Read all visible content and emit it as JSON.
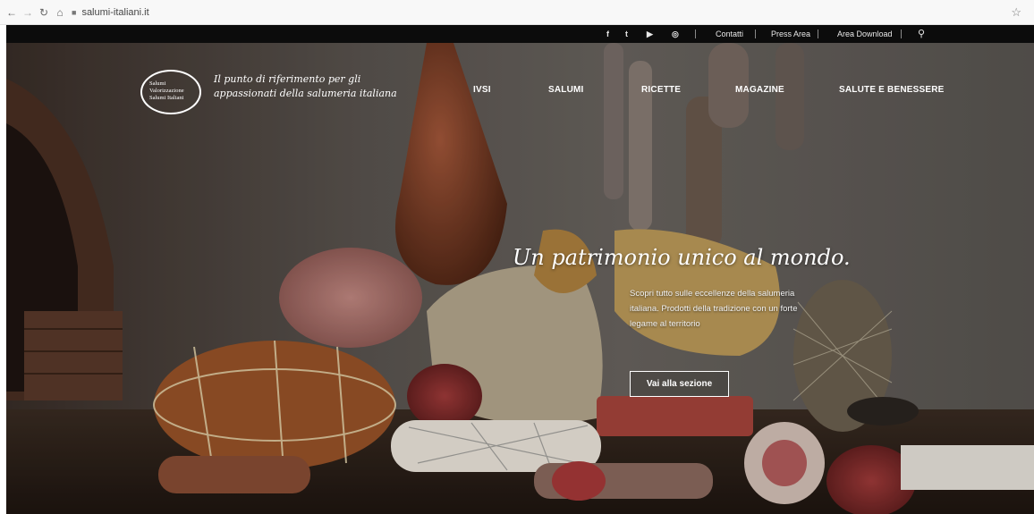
{
  "browser": {
    "url": "salumi-italiani.it"
  },
  "topbar": {
    "social": [
      "f",
      "t",
      "yt",
      "ig"
    ],
    "links": [
      "Contatti",
      "Press Area",
      "Area Download"
    ]
  },
  "logo": {
    "line1": "Salumi",
    "line2": "Valorizzazione",
    "line3": "Salumi Italiani"
  },
  "tagline": "Il punto di riferimento per gli appassionati della salumeria italiana",
  "nav": [
    "IVSI",
    "SALUMI",
    "RICETTE",
    "MAGAZINE",
    "SALUTE E BENESSERE"
  ],
  "hero": {
    "headline": "Un patrimonio unico al mondo.",
    "subtext": "Scopri tutto sulle eccellenze della salumeria italiana. Prodotti della tradizione con un forte legame al territorio",
    "cta": "Vai alla sezione"
  },
  "colors": {
    "topbar": "#0c0c0c",
    "background": "#2a2420",
    "text": "#ffffff"
  },
  "icons": [
    "back-icon",
    "forward-icon",
    "reload-icon",
    "home-icon",
    "lock-icon",
    "star-icon",
    "search-icon"
  ]
}
